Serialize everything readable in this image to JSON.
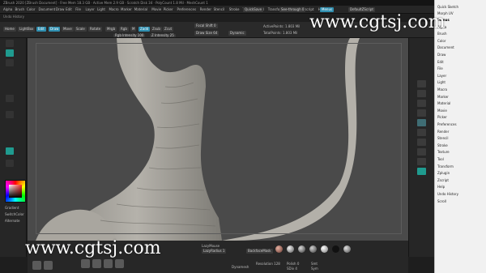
{
  "window": {
    "title": "ZBrush 2020 [ZBrush Document] · Free Mem 18.3 GB · Active Mem 2.9 GB · Scratch Disk 34 · PolyCount 1.8 Mil · MeshCount 1"
  },
  "menubar": {
    "items": [
      "Alpha",
      "Brush",
      "Color",
      "Document",
      "Draw",
      "Edit",
      "File",
      "Layer",
      "Light",
      "Macro",
      "Marker",
      "Material",
      "Movie",
      "Picker",
      "Preferences",
      "Render",
      "Stencil",
      "Stroke",
      "Texture",
      "Tool",
      "Transform",
      "Zplugin",
      "Zscript",
      "Help"
    ],
    "quicksave": "QuickSave",
    "see_through": "See-through 0",
    "menus": "Menus",
    "script": "DefaultZScript"
  },
  "status_text": "Undo History",
  "shelf": {
    "home": "Home",
    "lightbox": "LightBox",
    "edit": "Edit",
    "draw": "Draw",
    "move": "Move",
    "scale": "Scale",
    "rotate": "Rotate",
    "mrgb": "Mrgb",
    "rgb": "Rgb",
    "m": "M",
    "zadd": "Zadd",
    "zsub": "Zsub",
    "zcut": "Zcut",
    "focal_shift": "Focal Shift 0",
    "draw_size": "Draw Size 64",
    "dynamic": "Dynamic",
    "rgb_intensity": "Rgb Intensity 100",
    "z_intensity": "Z Intensity 25",
    "active_points": "ActivePoints: 1.803 Mil",
    "total_points": "TotalPoints: 1.803 Mil"
  },
  "left_panel": {
    "gradient": "Gradient",
    "switch_color": "SwitchColor",
    "alternate": "Alternate",
    "colors": [
      "#ff2a2a",
      "#ffffff",
      "#000000"
    ]
  },
  "right_menu": {
    "items": [
      "Quick Sketch",
      "Morph UV",
      "Menus",
      "Alpha",
      "Brush",
      "Color",
      "Document",
      "Draw",
      "Edit",
      "File",
      "Layer",
      "Light",
      "Macro",
      "Marker",
      "Material",
      "Movie",
      "Picker",
      "Preferences",
      "Render",
      "Stencil",
      "Stroke",
      "Texture",
      "Tool",
      "Transform",
      "Zplugin",
      "Zscript",
      "Help",
      "Undo History",
      "Scroll"
    ],
    "highlight": "Menus"
  },
  "bottom": {
    "lazy_mouse": "LazyMouse",
    "lazy_radius": "LazyRadius 1",
    "backface": "BackfaceMask",
    "materials": [
      "BasicMaterial",
      "MatCap Gray",
      "SkinShade4",
      "Toy Plastic",
      "BasicMaterial2",
      "Flat Color",
      "ReflectedMap"
    ],
    "dynamesh": "Dynamesh",
    "resolution": "Resolution 128",
    "polish": "Polish 0",
    "sdiv": "SDiv 4",
    "smt": "Smt",
    "sym": "Sym"
  },
  "watermark": "www.cgtsj.com",
  "colors": {
    "accent": "#2f8fb0",
    "teal": "#1f9b8f",
    "viewport": "#4a4a4a"
  }
}
